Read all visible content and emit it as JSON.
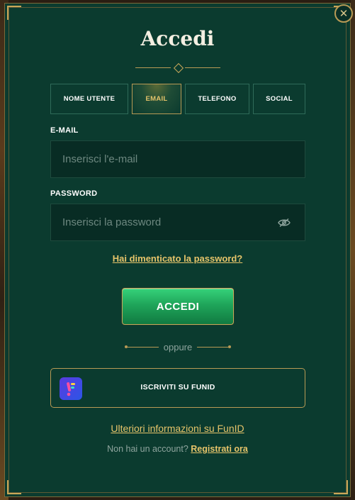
{
  "modal": {
    "title": "Accedi",
    "close_icon": "close-icon"
  },
  "tabs": [
    {
      "label": "NOME UTENTE",
      "active": false
    },
    {
      "label": "EMAIL",
      "active": true
    },
    {
      "label": "TELEFONO",
      "active": false
    },
    {
      "label": "SOCIAL",
      "active": false
    }
  ],
  "email": {
    "label": "E-MAIL",
    "placeholder": "Inserisci l'e-mail",
    "value": ""
  },
  "password": {
    "label": "PASSWORD",
    "placeholder": "Inserisci la password",
    "value": "",
    "toggle_icon": "eye-icon"
  },
  "forgot_link": "Hai dimenticato la password?",
  "login_button": "ACCEDI",
  "separator": "oppure",
  "funid": {
    "label": "ISCRIVITI SU FUNID",
    "logo_icon": "funid-logo-icon"
  },
  "more_info_link": "Ulteriori informazioni su FunID",
  "footer": {
    "no_account_text": "Non hai un account?",
    "register_link": "Registrati ora"
  },
  "colors": {
    "panel": "#0b3b2f",
    "gold": "#e6c46a",
    "button_green": "#1fa55a"
  }
}
